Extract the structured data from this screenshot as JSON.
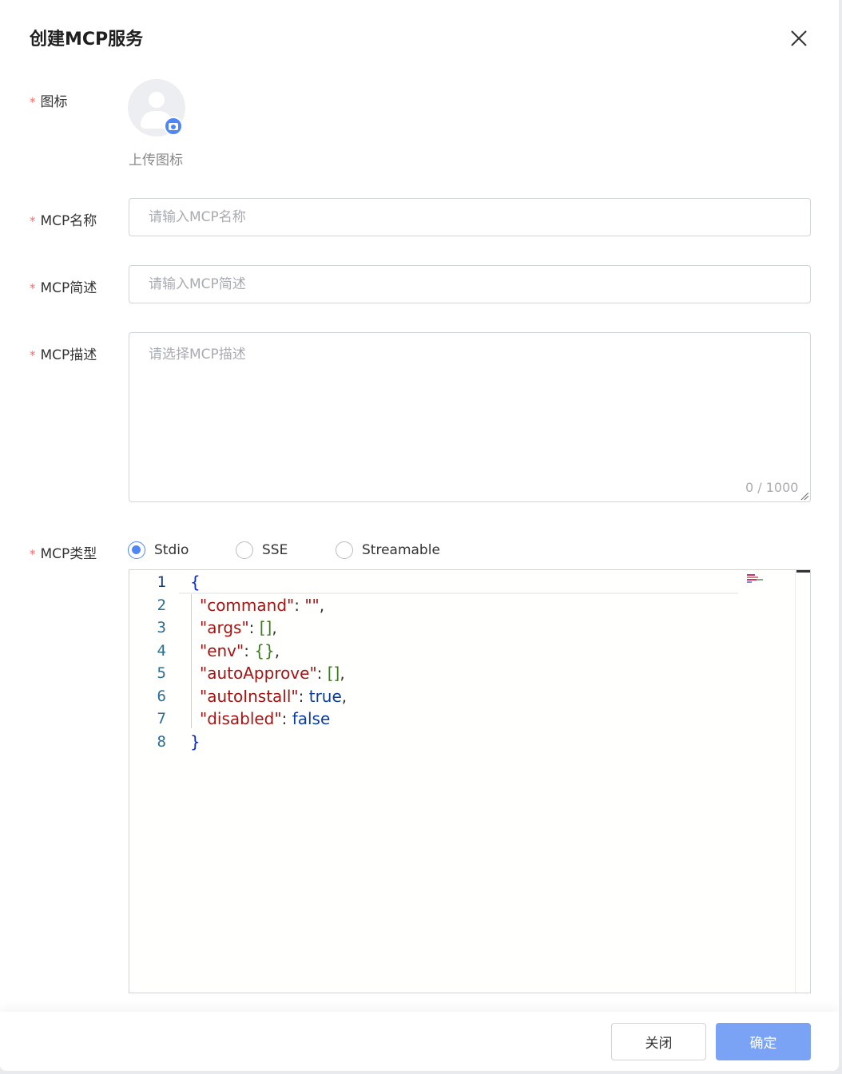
{
  "dialog": {
    "title": "创建MCP服务",
    "required_mark": "*"
  },
  "icon_field": {
    "label": "图标",
    "upload_label": "上传图标"
  },
  "name_field": {
    "label": "MCP名称",
    "placeholder": "请输入MCP名称",
    "value": ""
  },
  "brief_field": {
    "label": "MCP简述",
    "placeholder": "请输入MCP简述",
    "value": ""
  },
  "desc_field": {
    "label": "MCP描述",
    "placeholder": "请选择MCP描述",
    "value": "",
    "counter": "0 / 1000"
  },
  "type_field": {
    "label": "MCP类型",
    "options": [
      "Stdio",
      "SSE",
      "Streamable"
    ],
    "selected": "Stdio"
  },
  "editor": {
    "line_numbers": [
      "1",
      "2",
      "3",
      "4",
      "5",
      "6",
      "7",
      "8"
    ],
    "lines": [
      [
        {
          "t": "{",
          "c": "brace"
        }
      ],
      [
        {
          "t": "\"command\"",
          "c": "str"
        },
        {
          "t": ": ",
          "c": "punct"
        },
        {
          "t": "\"\"",
          "c": "str"
        },
        {
          "t": ",",
          "c": "punct"
        }
      ],
      [
        {
          "t": "\"args\"",
          "c": "str"
        },
        {
          "t": ": ",
          "c": "punct"
        },
        {
          "t": "[]",
          "c": "bracket"
        },
        {
          "t": ",",
          "c": "punct"
        }
      ],
      [
        {
          "t": "\"env\"",
          "c": "str"
        },
        {
          "t": ": ",
          "c": "punct"
        },
        {
          "t": "{}",
          "c": "bracket"
        },
        {
          "t": ",",
          "c": "punct"
        }
      ],
      [
        {
          "t": "\"autoApprove\"",
          "c": "str"
        },
        {
          "t": ": ",
          "c": "punct"
        },
        {
          "t": "[]",
          "c": "bracket"
        },
        {
          "t": ",",
          "c": "punct"
        }
      ],
      [
        {
          "t": "\"autoInstall\"",
          "c": "str"
        },
        {
          "t": ": ",
          "c": "punct"
        },
        {
          "t": "true",
          "c": "bool"
        },
        {
          "t": ",",
          "c": "punct"
        }
      ],
      [
        {
          "t": "\"disabled\"",
          "c": "str"
        },
        {
          "t": ": ",
          "c": "punct"
        },
        {
          "t": "false",
          "c": "bool"
        }
      ],
      [
        {
          "t": "}",
          "c": "brace"
        }
      ]
    ]
  },
  "footer": {
    "close_label": "关闭",
    "confirm_label": "确定"
  },
  "colors": {
    "primary": "#4f86f7",
    "primary_disabled": "#7aa3f5",
    "required": "#f56c6c"
  },
  "icons": [
    "close-icon",
    "avatar-placeholder-icon",
    "camera-icon",
    "resize-handle-icon"
  ]
}
